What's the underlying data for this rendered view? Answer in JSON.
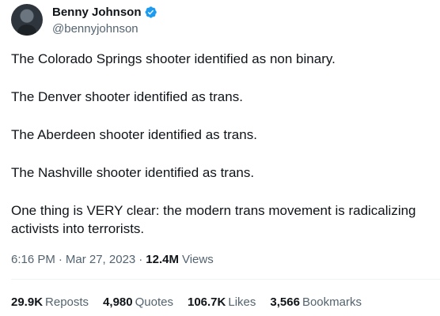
{
  "author": {
    "display_name": "Benny Johnson",
    "handle": "@bennyjohnson",
    "verified": true
  },
  "tweet": {
    "paragraphs": [
      "The Colorado Springs shooter identified as non binary.",
      "The Denver shooter identified as trans.",
      "The Aberdeen shooter identified as trans.",
      "The Nashville shooter identified as trans.",
      "One thing is VERY clear: the modern trans movement is radicalizing activists into terrorists."
    ],
    "time": "6:16 PM",
    "date": "Mar 27, 2023",
    "views_count": "12.4M",
    "views_label": "Views"
  },
  "stats": {
    "reposts": {
      "count": "29.9K",
      "label": "Reposts"
    },
    "quotes": {
      "count": "4,980",
      "label": "Quotes"
    },
    "likes": {
      "count": "106.7K",
      "label": "Likes"
    },
    "bookmarks": {
      "count": "3,566",
      "label": "Bookmarks"
    }
  },
  "colors": {
    "verified_blue": "#1d9bf0",
    "text_primary": "#0f1419",
    "text_secondary": "#536471"
  }
}
